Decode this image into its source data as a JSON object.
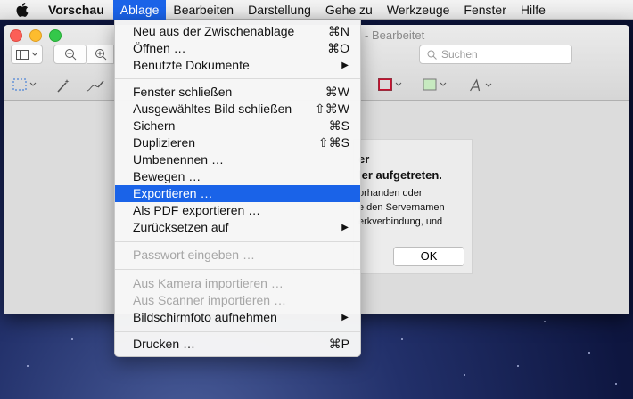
{
  "menubar": {
    "app": "Vorschau",
    "items": [
      {
        "label": "Ablage",
        "active": true
      },
      {
        "label": "Bearbeiten"
      },
      {
        "label": "Darstellung"
      },
      {
        "label": "Gehe zu"
      },
      {
        "label": "Werkzeuge"
      },
      {
        "label": "Fenster"
      },
      {
        "label": "Hilfe"
      }
    ]
  },
  "window": {
    "title_fragment": "- Bearbeitet",
    "search_placeholder": "Suchen"
  },
  "dialog": {
    "line1": "er",
    "line2": "ler aufgetreten.",
    "line3": "orhanden oder",
    "line4": "e den Servernamen",
    "line5": "erkverbindung, und",
    "ok_label": "OK"
  },
  "dropdown": {
    "items": [
      {
        "label": "Neu aus der Zwischenablage",
        "shortcut": "⌘N"
      },
      {
        "label": "Öffnen …",
        "shortcut": "⌘O"
      },
      {
        "label": "Benutzte Dokumente",
        "submenu": true
      },
      {
        "label": "Fenster schließen",
        "shortcut": "⌘W"
      },
      {
        "label": "Ausgewähltes Bild schließen",
        "shortcut": "⇧⌘W"
      },
      {
        "label": "Sichern",
        "shortcut": "⌘S"
      },
      {
        "label": "Duplizieren",
        "shortcut": "⇧⌘S"
      },
      {
        "label": "Umbenennen …"
      },
      {
        "label": "Bewegen …"
      },
      {
        "label": "Exportieren …",
        "highlighted": true
      },
      {
        "label": "Als PDF exportieren …"
      },
      {
        "label": "Zurücksetzen auf",
        "submenu": true
      },
      {
        "label": "Passwort eingeben …",
        "disabled": true
      },
      {
        "label": "Aus Kamera importieren …",
        "disabled": true
      },
      {
        "label": "Aus Scanner importieren …",
        "disabled": true
      },
      {
        "label": "Bildschirmfoto aufnehmen",
        "submenu": true
      },
      {
        "label": "Drucken …",
        "shortcut": "⌘P"
      }
    ]
  },
  "colors": {
    "highlight": "#1a63e8",
    "close": "#fc5f57",
    "minimize": "#fdbc2e",
    "zoom": "#34c84a"
  }
}
